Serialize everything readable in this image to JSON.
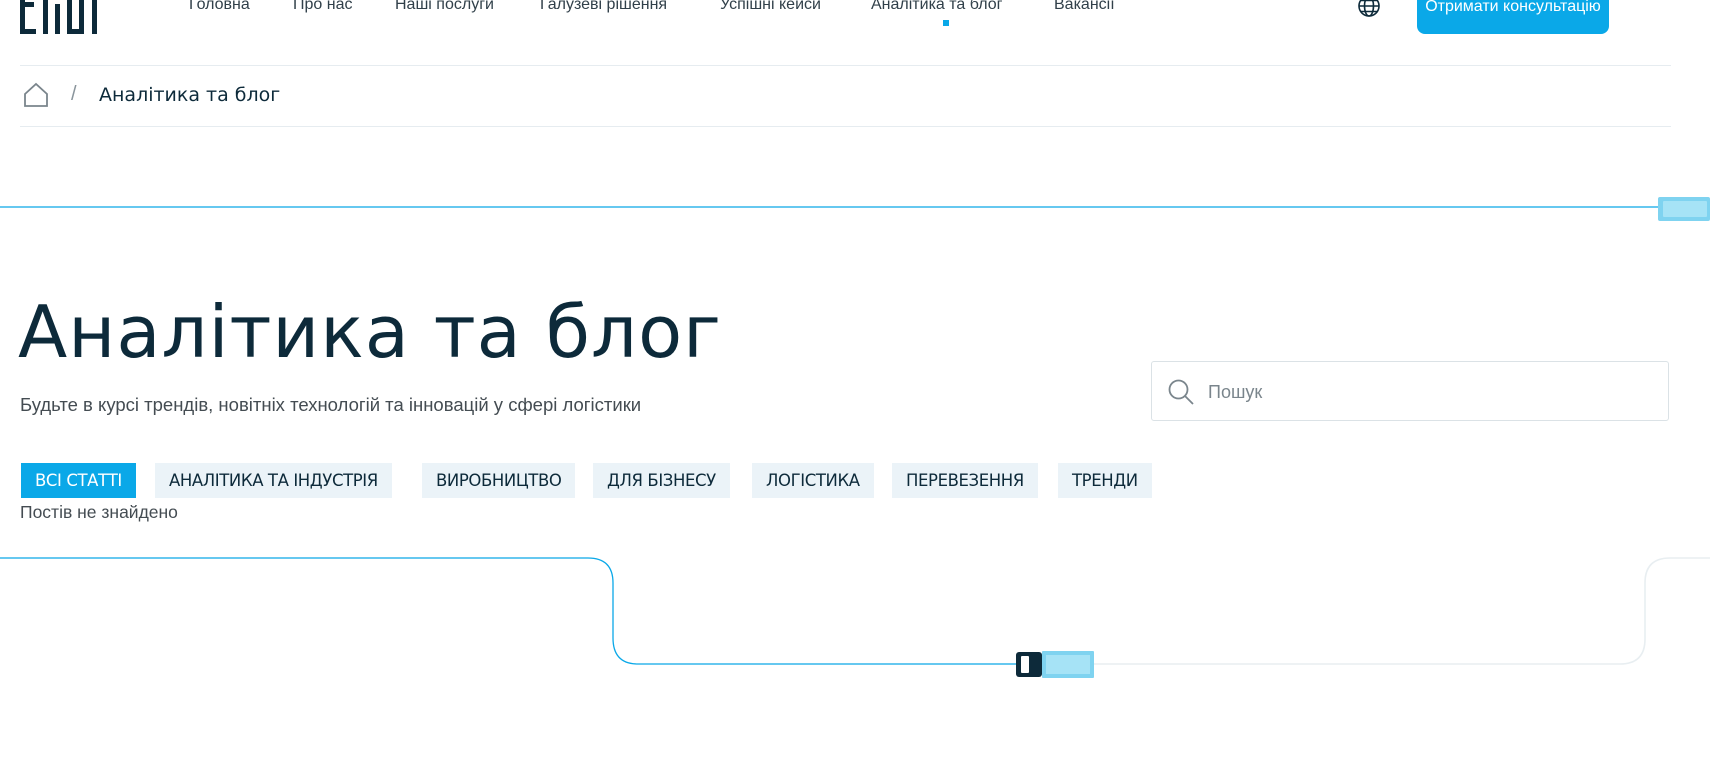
{
  "header": {
    "logo_text": "ERDI",
    "nav": [
      {
        "label": "Головна"
      },
      {
        "label": "Про нас"
      },
      {
        "label": "Наші послуги"
      },
      {
        "label": "Галузеві рішення"
      },
      {
        "label": "Успішні кейси"
      },
      {
        "label": "Аналітика та блог",
        "active": true
      },
      {
        "label": "Вакансії"
      }
    ],
    "cta_label": "Отримати консультацію"
  },
  "breadcrumb": {
    "separator": "/",
    "current": "Аналітика та блог"
  },
  "hero": {
    "title": "Аналітика та блог",
    "subtitle": "Будьте в курсі трендів, новітніх технологій та інновацій у сфері логістики"
  },
  "search": {
    "placeholder": "Пошук",
    "value": ""
  },
  "filters": {
    "tags": [
      {
        "label": "ВСІ СТАТТІ",
        "active": true
      },
      {
        "label": "АНАЛІТИКА ТА ІНДУСТРІЯ"
      },
      {
        "label": "ВИРОБНИЦТВО"
      },
      {
        "label": "ДЛЯ БІЗНЕСУ"
      },
      {
        "label": "ЛОГІСТИКА"
      },
      {
        "label": "ПЕРЕВЕЗЕННЯ"
      },
      {
        "label": "ТРЕНДИ"
      }
    ]
  },
  "empty_state": "Постів не знайдено",
  "colors": {
    "accent": "#0aa8e8",
    "text_dark": "#0d2a3a",
    "chip_bg": "#ebf3f8"
  },
  "icons": [
    "home-icon",
    "globe-icon",
    "search-icon",
    "truck-icon"
  ]
}
